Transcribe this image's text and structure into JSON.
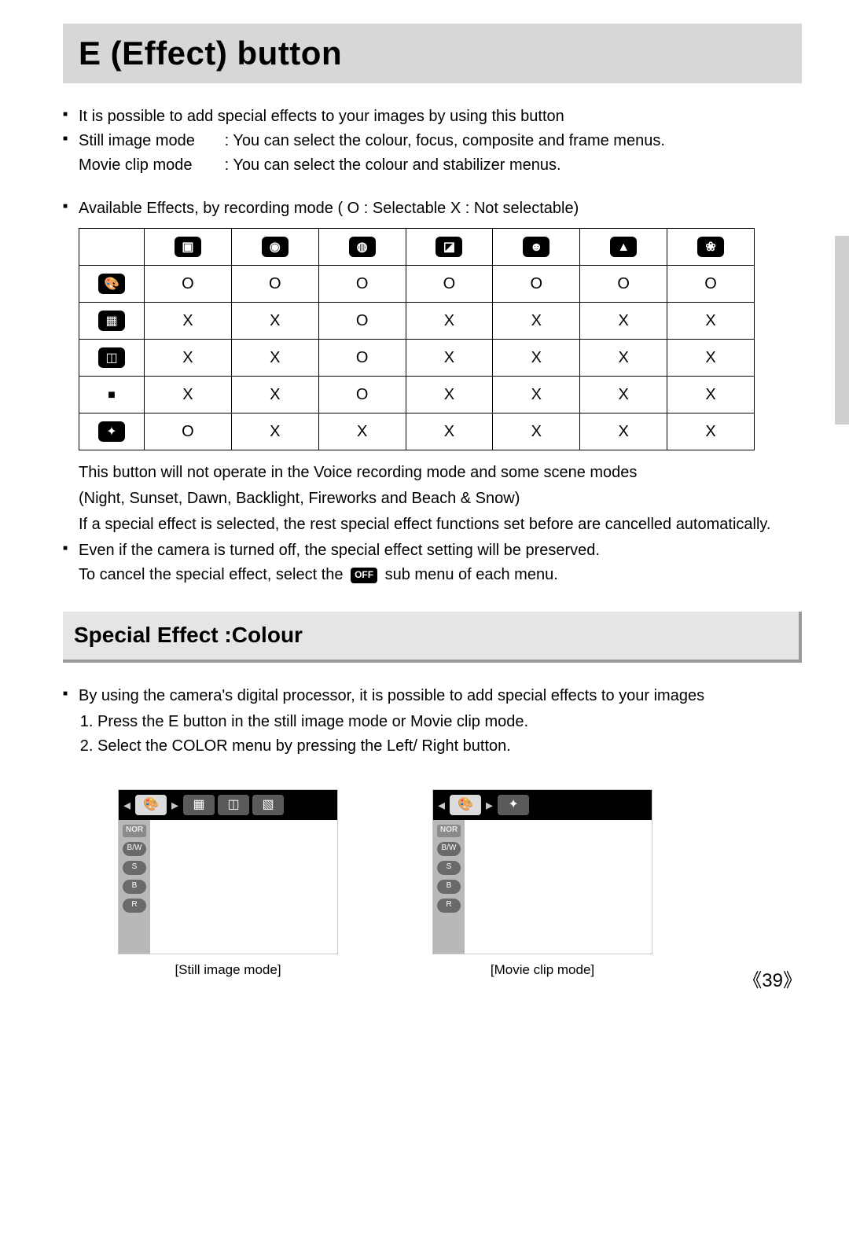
{
  "title": "E (Effect) button",
  "intro": {
    "l1": "It is possible to add special effects to your images by using this button",
    "mode1_k": "Still image mode",
    "mode1_v": ": You can select the colour, focus, composite and frame menus.",
    "mode2_k": "Movie clip mode",
    "mode2_v": ": You can select the colour and stabilizer menus.",
    "avail": "Available Effects, by recording mode ( O : Selectable X : Not selectable)"
  },
  "table": {
    "col_icons": [
      "movie-icon",
      "camera-icon",
      "camera-p-icon",
      "scene-icon",
      "portrait-icon",
      "landscape-icon",
      "macro-icon"
    ],
    "rows": [
      {
        "icon": "palette-icon",
        "v": [
          "O",
          "O",
          "O",
          "O",
          "O",
          "O",
          "O"
        ]
      },
      {
        "icon": "focus-icon",
        "v": [
          "X",
          "X",
          "O",
          "X",
          "X",
          "X",
          "X"
        ]
      },
      {
        "icon": "composite-icon",
        "v": [
          "X",
          "X",
          "O",
          "X",
          "X",
          "X",
          "X"
        ]
      },
      {
        "icon": "frame-icon",
        "v": [
          "X",
          "X",
          "O",
          "X",
          "X",
          "X",
          "X"
        ]
      },
      {
        "icon": "stabilizer-icon",
        "v": [
          "O",
          "X",
          "X",
          "X",
          "X",
          "X",
          "X"
        ]
      }
    ]
  },
  "notes": {
    "n1": "This button will not operate in the Voice recording mode and some scene modes",
    "n2": "(Night, Sunset, Dawn, Backlight, Fireworks and Beach & Snow)",
    "n3": "If a special effect is selected, the rest special effect functions set before are cancelled automatically.",
    "n4": "Even if the camera is turned off, the special effect setting will be preserved.",
    "n5a": "To cancel the special effect, select the",
    "n5b": "sub menu of each menu.",
    "off": "OFF"
  },
  "section": {
    "head": "Special Effect :Colour",
    "lead": "By using the camera's digital processor, it is possible to add special effects to your images",
    "step1": "Press the E button in the still image mode or Movie clip mode.",
    "step2": "Select the COLOR menu by pressing the Left/ Right button."
  },
  "screens": {
    "side_labels": [
      "NOR",
      "B/W",
      "S",
      "B",
      "R"
    ],
    "cap1": "[Still image mode]",
    "cap2": "[Movie clip mode]"
  },
  "page_num": "《39》"
}
